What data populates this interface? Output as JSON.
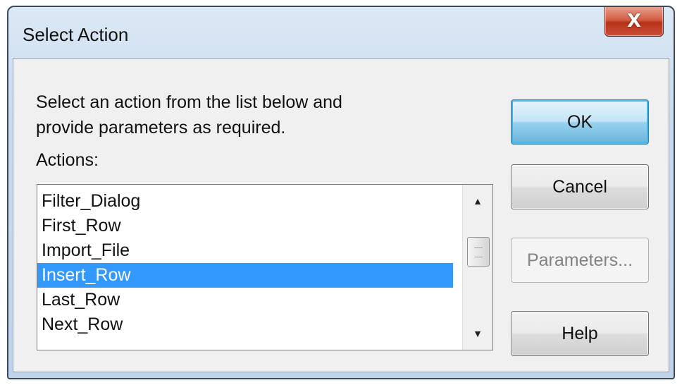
{
  "window": {
    "title": "Select Action",
    "close_glyph": "X"
  },
  "description": "Select an action from the list below and\nprovide parameters as required.",
  "actions_label": "Actions:",
  "actions_list": {
    "items": [
      {
        "label": "Filter_Dialog",
        "selected": false
      },
      {
        "label": "First_Row",
        "selected": false
      },
      {
        "label": "Import_File",
        "selected": false
      },
      {
        "label": "Insert_Row",
        "selected": true
      },
      {
        "label": "Last_Row",
        "selected": false
      },
      {
        "label": "Next_Row",
        "selected": false
      }
    ],
    "selected_color": "#3399ff"
  },
  "scrollbar": {
    "up_glyph": "▲",
    "down_glyph": "▼"
  },
  "buttons": {
    "ok": "OK",
    "cancel": "Cancel",
    "parameters": "Parameters...",
    "help": "Help"
  },
  "colors": {
    "close_button": "#c9503a",
    "default_button": "#98d1ef"
  }
}
